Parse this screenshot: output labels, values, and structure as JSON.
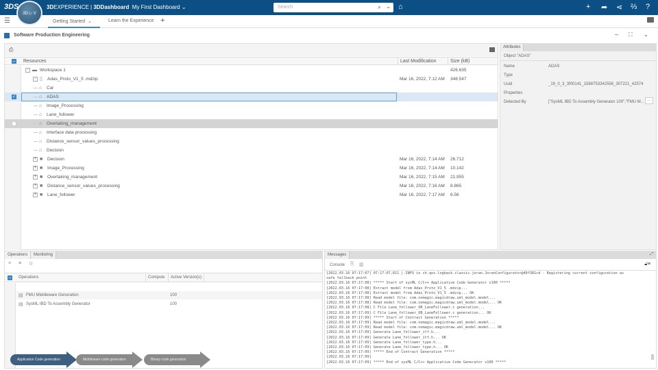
{
  "topbar": {
    "logo": "3DS",
    "compass": "3D ▷ V",
    "brand_bold": "3D",
    "brand_rest": "EXPERIENCE | ",
    "app": "3DDashboard",
    "dashboard": "My First Dashboard",
    "search_placeholder": "Search"
  },
  "tabs": [
    {
      "label": "Getting Started"
    },
    {
      "label": "Learn the Experience"
    }
  ],
  "widget": {
    "title": "Software Production Engineering"
  },
  "tree": {
    "columns": {
      "resources": "Resources",
      "modified": "Last Modification",
      "size": "Size (kB)"
    },
    "rows": [
      {
        "label": "Workspace 1",
        "level": 0,
        "icon": "workspace",
        "expander": "-",
        "modified": "",
        "size": "426.635"
      },
      {
        "label": "Adas_Proto_V1_5 .mdzip",
        "level": 1,
        "icon": "file",
        "expander": "-",
        "modified": "Mar 16, 2022, 7:12 AM",
        "size": "348.547"
      },
      {
        "label": "Car",
        "level": 2,
        "icon": "block",
        "expander": "",
        "modified": "",
        "size": ""
      },
      {
        "label": "ADAS",
        "level": 2,
        "icon": "block",
        "expander": "",
        "modified": "",
        "size": "",
        "state": "selected",
        "checked": true
      },
      {
        "label": "Image_Processing",
        "level": 2,
        "icon": "block",
        "expander": "",
        "modified": "",
        "size": ""
      },
      {
        "label": "Lane_follower",
        "level": 2,
        "icon": "block",
        "expander": "",
        "modified": "",
        "size": ""
      },
      {
        "label": "Overtaking_management",
        "level": 2,
        "icon": "block",
        "expander": "",
        "modified": "",
        "size": "",
        "state": "hover",
        "checked": false
      },
      {
        "label": "Interface data processing",
        "level": 2,
        "icon": "block",
        "expander": "",
        "modified": "",
        "size": ""
      },
      {
        "label": "Distance_sensor_values_processing",
        "level": 2,
        "icon": "block",
        "expander": "",
        "modified": "",
        "size": ""
      },
      {
        "label": "Decision",
        "level": 2,
        "icon": "block",
        "expander": "",
        "modified": "",
        "size": ""
      },
      {
        "label": "Decision",
        "level": 1,
        "icon": "folder",
        "expander": "+",
        "modified": "Mar 16, 2022, 7:14 AM",
        "size": "26.712"
      },
      {
        "label": "Image_Processing",
        "level": 1,
        "icon": "folder",
        "expander": "+",
        "modified": "Mar 16, 2022, 7:14 AM",
        "size": "10.142"
      },
      {
        "label": "Overtaking_management",
        "level": 1,
        "icon": "folder",
        "expander": "+",
        "modified": "Mar 16, 2022, 7:15 AM",
        "size": "21.955"
      },
      {
        "label": "Distance_sensor_values_processing",
        "level": 1,
        "icon": "folder",
        "expander": "+",
        "modified": "Mar 16, 2022, 7:16 AM",
        "size": "8.865"
      },
      {
        "label": "Lane_follower",
        "level": 1,
        "icon": "folder",
        "expander": "+",
        "modified": "Mar 16, 2022, 7:17 AM",
        "size": "6.56"
      }
    ]
  },
  "attributes": {
    "tab": "Attributes",
    "object": "Object \"ADAS\"",
    "fields": [
      {
        "key": "Name",
        "value": "ADAS"
      },
      {
        "key": "Type",
        "value": ""
      },
      {
        "key": "Uuid",
        "value": "_19_0_3_3f00141_1588753342556_307221_42574"
      },
      {
        "key": "Properties",
        "value": ""
      },
      {
        "key": "Detected By",
        "value": "[\"SysML IBD To Assembly Generator 100\",\"FMU M..."
      }
    ],
    "more": "..."
  },
  "operations": {
    "tabs": [
      "Operations",
      "Monitoring"
    ],
    "columns": [
      "Operations",
      "Compute",
      "Active Version(s)"
    ],
    "rows": [
      {
        "name": "FMU Middleware Generation",
        "compute": "",
        "version": "100"
      },
      {
        "name": "SysML IBD To Assembly Generator",
        "compute": "",
        "version": "100"
      }
    ],
    "steps": [
      {
        "label": "Application Code generation",
        "color": "#3f5f80"
      },
      {
        "label": "Middleware code generation",
        "color": "#8a8a8a"
      },
      {
        "label": "Binary code generation",
        "color": "#8a8a8a"
      }
    ]
  },
  "messages": {
    "tab": "Messages",
    "console": "Console",
    "lines": [
      "[2022.03.16 07:17:07] 07:17:07,811 |-INFO in ch.qos.logback.classic.joran.JoranConfigurator@40f381cd - Registering current configuration as",
      "safe fallback point",
      "[2022.03.16 07:17:08] ***** Start of sysML C/C++ Applicative Code Generator v100 *****",
      "[2022.03.16 07:17:08] Extract model from Adas_Proto_V1_5 .mdzip...",
      "[2022.03.16 07:17:08] Extract model from Adas_Proto_V1_5 .mdzip... OK",
      "[2022.03.16 07:17:08] Read model file: com.nomagic.magicdraw.uml_model.model...",
      "[2022.03.16 07:17:08] Read model file: com.nomagic.magicdraw.uml_model.model... OK",
      "[2022.03.16 07:17:08] C File Lane_follower_OB_LaneFollower.c generation...",
      "[2022.03.16 07:17:09] C File Lane_follower_OB_LaneFollower.c generation... OK",
      "[2022.03.16 07:17:09] ***** Start of Contract Generation *****",
      "[2022.03.16 07:17:09] Read model file: com.nomagic.magicdraw.uml_model.model...",
      "[2022.03.16 07:17:09] Read model file: com.nomagic.magicdraw.uml_model.model... OK",
      "[2022.03.16 07:17:09] Generate Lane_follower_itf.h...",
      "[2022.03.16 07:17:09] Generate Lane_follower_itf.h... OK",
      "[2022.03.16 07:17:09] Generate Lane_follower_type.h...",
      "[2022.03.16 07:17:09] Generate Lane_follower_type.h... OK",
      "[2022.03.16 07:17:09] ***** End of Contract Generation *****",
      "[2022.03.16 07:17:09]",
      "[2022.03.16 07:17:09] ***** End of sysML C/C++ Applicative Code Generator v100 *****"
    ]
  }
}
